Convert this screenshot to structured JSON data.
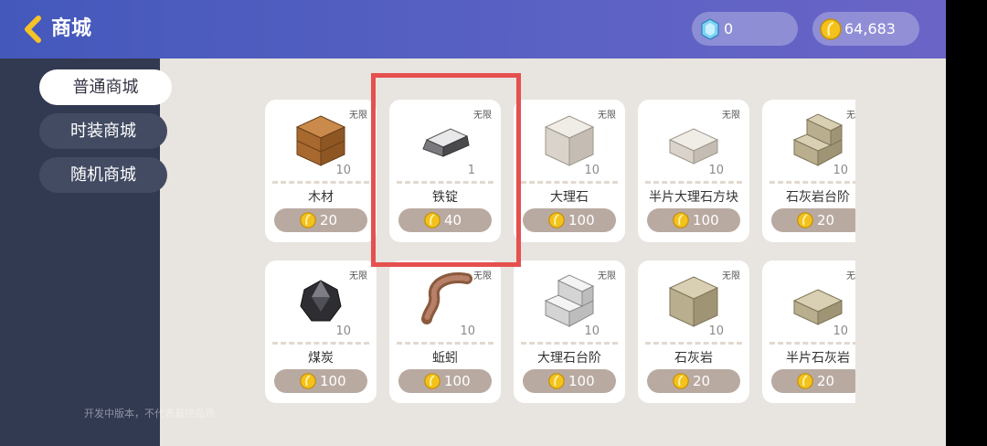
{
  "header": {
    "title": "商城",
    "diamonds": "0",
    "coins": "64,683"
  },
  "sidebar": {
    "tabs": [
      {
        "label": "普通商城",
        "active": true
      },
      {
        "label": "时装商城",
        "active": false
      },
      {
        "label": "随机商城",
        "active": false
      }
    ],
    "footnote": "开发中版本，不代表最终品质"
  },
  "items": [
    {
      "name": "木材",
      "limit": "无限",
      "qty": "10",
      "price": "20",
      "icon": "wood-block"
    },
    {
      "name": "铁锭",
      "limit": "无限",
      "qty": "1",
      "price": "40",
      "icon": "iron-ingot",
      "highlighted": true
    },
    {
      "name": "大理石",
      "limit": "无限",
      "qty": "10",
      "price": "100",
      "icon": "marble-block"
    },
    {
      "name": "半片大理石方块",
      "limit": "无限",
      "qty": "10",
      "price": "100",
      "icon": "marble-slab"
    },
    {
      "name": "石灰岩台阶",
      "limit": "无限",
      "qty": "10",
      "price": "20",
      "icon": "limestone-stairs"
    },
    {
      "name": "煤炭",
      "limit": "无限",
      "qty": "10",
      "price": "100",
      "icon": "coal"
    },
    {
      "name": "蚯蚓",
      "limit": "无限",
      "qty": "10",
      "price": "100",
      "icon": "earthworm"
    },
    {
      "name": "大理石台阶",
      "limit": "无限",
      "qty": "10",
      "price": "100",
      "icon": "marble-stairs"
    },
    {
      "name": "石灰岩",
      "limit": "无限",
      "qty": "10",
      "price": "20",
      "icon": "limestone-block"
    },
    {
      "name": "半片石灰岩",
      "limit": "无限",
      "qty": "10",
      "price": "20",
      "icon": "limestone-slab"
    }
  ],
  "colors": {
    "topbar": "#4f5ec0",
    "sidebar": "#323a52",
    "highlight": "#e5504e",
    "price_pill": "#b9aaa1"
  }
}
